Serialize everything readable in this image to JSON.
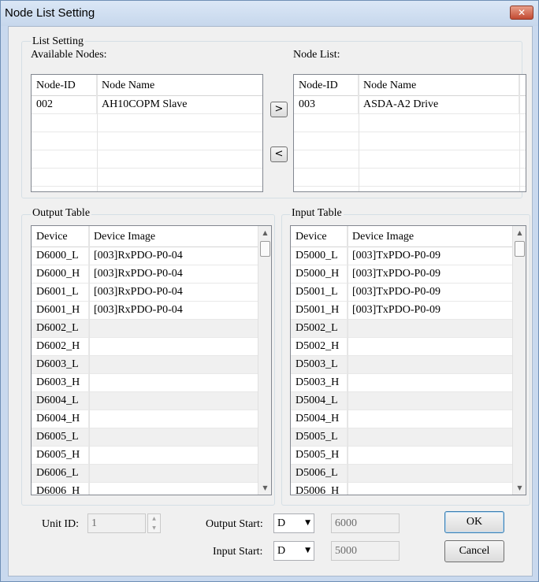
{
  "window": {
    "title": "Node List Setting",
    "close_glyph": "✕"
  },
  "list_setting": {
    "legend": "List Setting",
    "available_label": "Available Nodes:",
    "nodelist_label": "Node List:",
    "columns": [
      "Node-ID",
      "Node Name"
    ],
    "available_nodes": [
      {
        "id": "002",
        "name": "AH10COPM Slave"
      }
    ],
    "node_list": [
      {
        "id": "003",
        "name": "ASDA-A2 Drive"
      }
    ],
    "move_right": ">",
    "move_left": "<"
  },
  "output_table": {
    "legend": "Output Table",
    "columns": [
      "Device",
      "Device Image"
    ],
    "rows": [
      {
        "device": "D6000_L",
        "image": "[003]RxPDO-P0-04"
      },
      {
        "device": "D6000_H",
        "image": "[003]RxPDO-P0-04"
      },
      {
        "device": "D6001_L",
        "image": "[003]RxPDO-P0-04"
      },
      {
        "device": "D6001_H",
        "image": "[003]RxPDO-P0-04"
      },
      {
        "device": "D6002_L",
        "image": ""
      },
      {
        "device": "D6002_H",
        "image": ""
      },
      {
        "device": "D6003_L",
        "image": ""
      },
      {
        "device": "D6003_H",
        "image": ""
      },
      {
        "device": "D6004_L",
        "image": ""
      },
      {
        "device": "D6004_H",
        "image": ""
      },
      {
        "device": "D6005_L",
        "image": ""
      },
      {
        "device": "D6005_H",
        "image": ""
      },
      {
        "device": "D6006_L",
        "image": ""
      },
      {
        "device": "D6006_H",
        "image": ""
      }
    ]
  },
  "input_table": {
    "legend": "Input Table",
    "columns": [
      "Device",
      "Device Image"
    ],
    "rows": [
      {
        "device": "D5000_L",
        "image": "[003]TxPDO-P0-09"
      },
      {
        "device": "D5000_H",
        "image": "[003]TxPDO-P0-09"
      },
      {
        "device": "D5001_L",
        "image": "[003]TxPDO-P0-09"
      },
      {
        "device": "D5001_H",
        "image": "[003]TxPDO-P0-09"
      },
      {
        "device": "D5002_L",
        "image": ""
      },
      {
        "device": "D5002_H",
        "image": ""
      },
      {
        "device": "D5003_L",
        "image": ""
      },
      {
        "device": "D5003_H",
        "image": ""
      },
      {
        "device": "D5004_L",
        "image": ""
      },
      {
        "device": "D5004_H",
        "image": ""
      },
      {
        "device": "D5005_L",
        "image": ""
      },
      {
        "device": "D5005_H",
        "image": ""
      },
      {
        "device": "D5006_L",
        "image": ""
      },
      {
        "device": "D5006_H",
        "image": ""
      }
    ]
  },
  "scroll_glyphs": {
    "up": "▲",
    "down": "▼"
  },
  "footer": {
    "unit_id_label": "Unit ID:",
    "unit_id_value": "1",
    "output_start_label": "Output Start:",
    "output_start_type": "D",
    "output_start_value": "6000",
    "input_start_label": "Input Start:",
    "input_start_type": "D",
    "input_start_value": "5000",
    "ok_label": "OK",
    "cancel_label": "Cancel",
    "dropdown_glyph": "▼"
  },
  "colors": {
    "window_frame": "#c9d9ee",
    "client_bg": "#f0f0f0",
    "close_button": "#c24a32"
  }
}
